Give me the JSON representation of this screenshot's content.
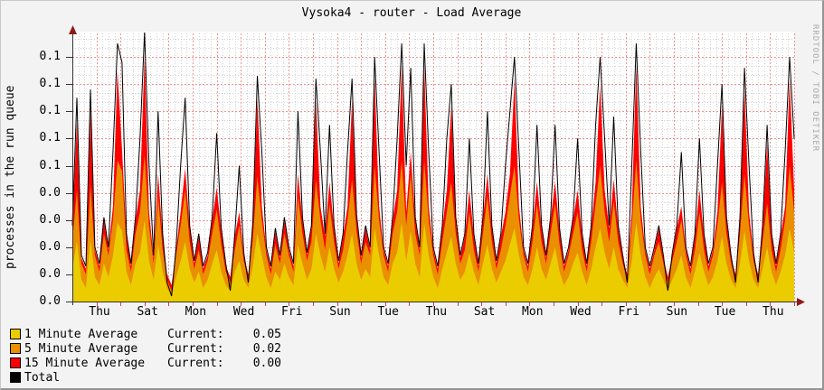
{
  "chart_data": {
    "type": "area",
    "title": "Vysoka4 - router - Load Average",
    "ylabel": "processes in the run queue",
    "watermark": "RRDTOOL / TOBI OETIKER",
    "x_tick_labels": [
      "Thu",
      "Sat",
      "Mon",
      "Wed",
      "Fri",
      "Sun",
      "Tue",
      "Thu",
      "Sat",
      "Mon",
      "Wed",
      "Fri",
      "Sun",
      "Tue",
      "Thu"
    ],
    "x_tick_spacing_days": 2,
    "x_range_days": 30,
    "y_tick_labels_top_to_bottom": [
      "0.1",
      "0.1",
      "0.1",
      "0.1",
      "0.1",
      "0.0",
      "0.0",
      "0.0",
      "0.0",
      "0.0"
    ],
    "y_tick_step": 0.01,
    "ylim": [
      0,
      0.105
    ],
    "value_note": "values stored in thousandths of a load unit (99 = 0.099)",
    "grid": {
      "major_color": "#ef9393",
      "minor_color": "#d2d2d2",
      "background": "#ffffff"
    },
    "series": [
      {
        "name": "15 Minute Average",
        "color": "#ff0000",
        "style": "area",
        "values_milli": [
          27,
          66,
          16,
          12,
          70,
          19,
          13,
          30,
          19,
          35,
          85,
          56,
          24,
          13,
          30,
          41,
          90,
          33,
          16,
          47,
          24,
          10,
          6,
          19,
          33,
          49,
          27,
          14,
          24,
          12,
          17,
          30,
          42,
          26,
          13,
          9,
          24,
          33,
          17,
          10,
          28,
          75,
          35,
          19,
          12,
          26,
          16,
          30,
          19,
          13,
          47,
          30,
          17,
          27,
          74,
          35,
          24,
          44,
          27,
          14,
          24,
          35,
          74,
          31,
          16,
          27,
          19,
          82,
          35,
          19,
          13,
          30,
          41,
          87,
          33,
          55,
          30,
          19,
          87,
          35,
          19,
          12,
          27,
          41,
          72,
          30,
          16,
          24,
          41,
          24,
          13,
          30,
          47,
          27,
          14,
          24,
          33,
          47,
          82,
          35,
          19,
          13,
          27,
          44,
          27,
          16,
          30,
          44,
          26,
          13,
          19,
          30,
          41,
          24,
          13,
          27,
          44,
          80,
          41,
          27,
          45,
          27,
          16,
          10,
          33,
          87,
          35,
          19,
          12,
          19,
          27,
          16,
          9,
          17,
          27,
          35,
          19,
          12,
          24,
          41,
          24,
          13,
          19,
          33,
          72,
          30,
          16,
          10,
          30,
          78,
          33,
          17,
          10,
          27,
          58,
          24,
          13,
          24,
          35,
          82,
          41
        ]
      },
      {
        "name": "5 Minute Average",
        "color": "#ea8f00",
        "style": "area",
        "values_milli": [
          22,
          41,
          14,
          10,
          43,
          17,
          11,
          25,
          17,
          30,
          52,
          48,
          19,
          11,
          25,
          33,
          54,
          28,
          14,
          39,
          19,
          8,
          4,
          17,
          28,
          41,
          22,
          12,
          19,
          10,
          15,
          25,
          34,
          21,
          11,
          7,
          19,
          28,
          15,
          8,
          23,
          46,
          30,
          17,
          10,
          21,
          14,
          25,
          17,
          11,
          39,
          25,
          15,
          22,
          45,
          30,
          19,
          36,
          22,
          12,
          19,
          30,
          45,
          26,
          14,
          22,
          17,
          50,
          30,
          17,
          11,
          25,
          33,
          52,
          28,
          47,
          25,
          17,
          52,
          30,
          17,
          10,
          22,
          33,
          44,
          25,
          14,
          19,
          33,
          19,
          11,
          25,
          39,
          22,
          12,
          19,
          28,
          39,
          50,
          30,
          17,
          11,
          22,
          36,
          22,
          14,
          25,
          36,
          21,
          11,
          17,
          25,
          33,
          19,
          11,
          22,
          36,
          50,
          33,
          22,
          37,
          22,
          14,
          8,
          28,
          52,
          30,
          17,
          10,
          17,
          22,
          14,
          7,
          15,
          22,
          30,
          17,
          10,
          19,
          33,
          19,
          11,
          17,
          28,
          44,
          25,
          14,
          8,
          25,
          47,
          28,
          15,
          8,
          22,
          36,
          19,
          11,
          19,
          30,
          50,
          33
        ]
      },
      {
        "name": "1 Minute Average",
        "color": "#eacc00",
        "style": "area",
        "values_milli": [
          12,
          22,
          8,
          5,
          23,
          9,
          6,
          14,
          9,
          17,
          29,
          26,
          11,
          6,
          14,
          18,
          30,
          15,
          8,
          21,
          11,
          5,
          2,
          9,
          15,
          22,
          12,
          7,
          11,
          5,
          8,
          14,
          19,
          11,
          6,
          4,
          11,
          15,
          8,
          5,
          13,
          25,
          17,
          9,
          5,
          11,
          8,
          14,
          9,
          6,
          21,
          14,
          8,
          12,
          25,
          17,
          11,
          20,
          12,
          7,
          11,
          17,
          25,
          14,
          8,
          12,
          9,
          27,
          17,
          9,
          6,
          14,
          18,
          29,
          15,
          26,
          14,
          9,
          29,
          17,
          9,
          5,
          12,
          18,
          24,
          14,
          8,
          11,
          18,
          11,
          6,
          14,
          21,
          12,
          7,
          11,
          15,
          21,
          27,
          17,
          9,
          6,
          12,
          20,
          12,
          8,
          14,
          20,
          11,
          6,
          9,
          14,
          18,
          11,
          6,
          12,
          20,
          27,
          18,
          12,
          20,
          12,
          8,
          5,
          15,
          29,
          17,
          9,
          5,
          9,
          12,
          8,
          4,
          8,
          12,
          17,
          9,
          5,
          11,
          18,
          11,
          6,
          9,
          15,
          24,
          14,
          8,
          5,
          14,
          26,
          15,
          8,
          5,
          12,
          20,
          11,
          6,
          11,
          17,
          27,
          18
        ]
      },
      {
        "name": "Total",
        "color": "#000000",
        "style": "line",
        "values_milli": [
          28,
          75,
          17,
          13,
          78,
          20,
          14,
          31,
          20,
          55,
          95,
          88,
          25,
          14,
          31,
          60,
          99,
          50,
          17,
          70,
          25,
          7,
          2,
          20,
          50,
          75,
          28,
          15,
          25,
          13,
          18,
          31,
          62,
          27,
          14,
          4,
          25,
          50,
          18,
          7,
          29,
          83,
          55,
          20,
          13,
          27,
          17,
          31,
          20,
          14,
          70,
          31,
          18,
          28,
          82,
          55,
          25,
          65,
          28,
          15,
          25,
          55,
          82,
          32,
          17,
          28,
          20,
          90,
          55,
          20,
          14,
          31,
          60,
          95,
          50,
          86,
          31,
          20,
          95,
          55,
          20,
          13,
          28,
          60,
          80,
          31,
          17,
          25,
          60,
          25,
          14,
          31,
          70,
          28,
          15,
          25,
          50,
          70,
          90,
          55,
          20,
          14,
          28,
          65,
          28,
          17,
          31,
          65,
          27,
          14,
          20,
          31,
          60,
          25,
          14,
          28,
          65,
          90,
          60,
          28,
          68,
          28,
          17,
          7,
          50,
          95,
          55,
          20,
          13,
          20,
          28,
          17,
          4,
          18,
          28,
          55,
          20,
          13,
          25,
          60,
          25,
          14,
          20,
          50,
          80,
          31,
          17,
          7,
          31,
          86,
          50,
          18,
          7,
          28,
          65,
          25,
          14,
          25,
          55,
          90,
          60
        ]
      }
    ]
  },
  "legend": {
    "rows": [
      {
        "swatch": "#eacc00",
        "label": "1 Minute Average",
        "current_label": "Current:",
        "current_value": "0.05"
      },
      {
        "swatch": "#ea8f00",
        "label": "5 Minute Average",
        "current_label": "Current:",
        "current_value": "0.02"
      },
      {
        "swatch": "#ff0000",
        "label": "15 Minute Average",
        "current_label": "Current:",
        "current_value": "0.00"
      },
      {
        "swatch": "#000000",
        "label": "Total",
        "current_label": "",
        "current_value": ""
      }
    ]
  },
  "frame": {
    "background": "#f3f3f3",
    "arrow_color": "#8c1b1b",
    "axis_color": "#333333",
    "x_tick_color": "#cc4444"
  }
}
